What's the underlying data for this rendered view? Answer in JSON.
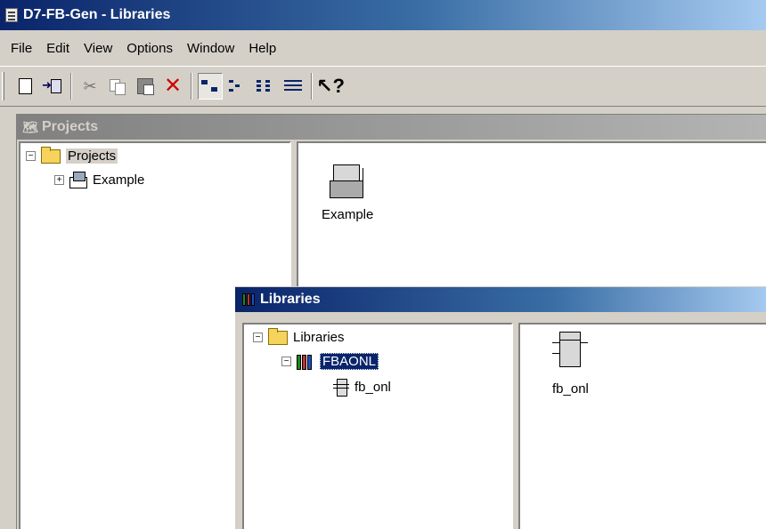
{
  "window": {
    "title": "D7-FB-Gen - Libraries"
  },
  "menu": [
    "File",
    "Edit",
    "View",
    "Options",
    "Window",
    "Help"
  ],
  "toolbar": {
    "buttons": [
      "new-icon",
      "import-icon",
      "cut-icon",
      "copy-icon",
      "paste-icon",
      "delete-icon",
      "large-icons-icon",
      "small-icons-icon",
      "list-icon",
      "details-icon",
      "context-help-icon"
    ]
  },
  "projects_window": {
    "title": "Projects",
    "tree": {
      "root": "Projects",
      "children": [
        "Example"
      ]
    },
    "items": [
      "Example"
    ]
  },
  "libraries_window": {
    "title": "Libraries",
    "tree": {
      "root": "Libraries",
      "library": "FBAONL",
      "block": "fb_onl"
    },
    "items": [
      "fb_onl"
    ]
  },
  "colors": {
    "active_title": "#0a246a",
    "inactive_title": "#808080",
    "face": "#d4d0c8",
    "selection": "#0a246a"
  }
}
